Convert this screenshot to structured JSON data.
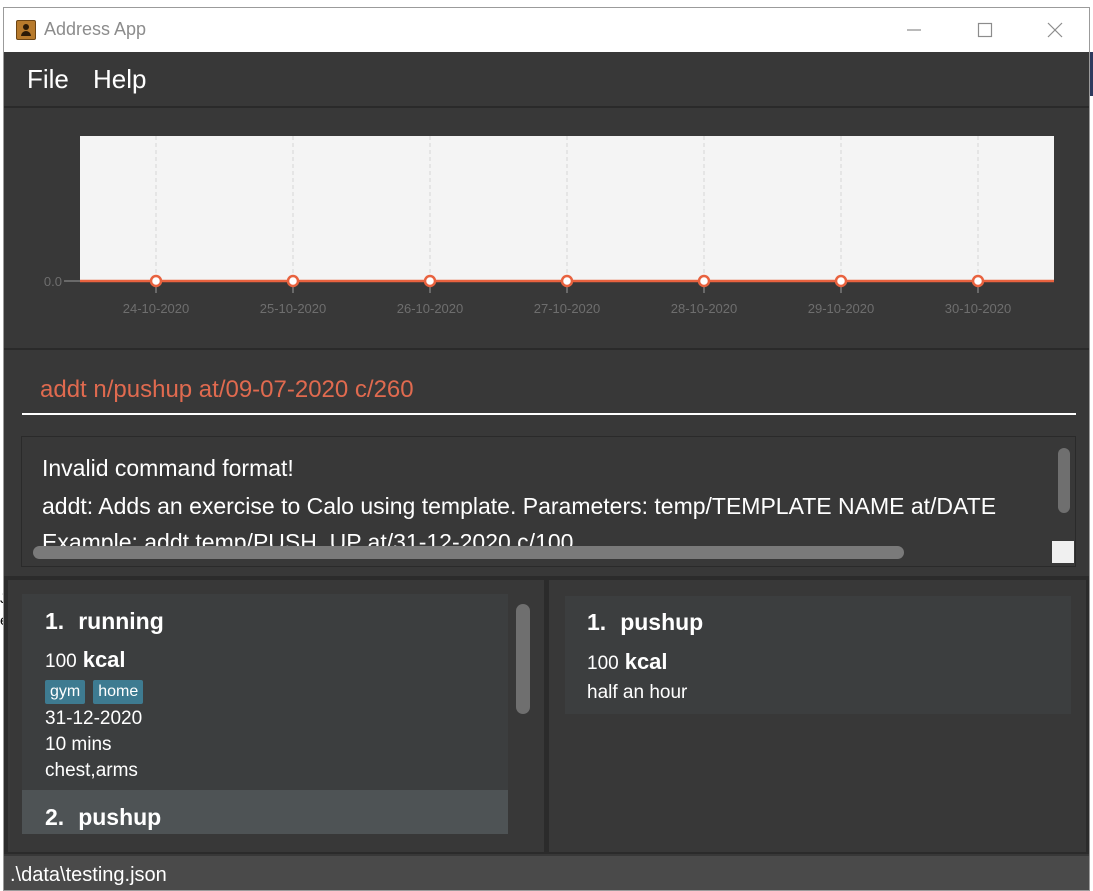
{
  "window": {
    "title": "Address App",
    "icon": "address-book-icon"
  },
  "menu": {
    "file": "File",
    "help": "Help"
  },
  "chart_data": {
    "type": "line",
    "x": [
      "24-10-2020",
      "25-10-2020",
      "26-10-2020",
      "27-10-2020",
      "28-10-2020",
      "29-10-2020",
      "30-10-2020"
    ],
    "series": [
      {
        "values": [
          0,
          0,
          0,
          0,
          0,
          0,
          0
        ],
        "color": "#e8623f"
      }
    ],
    "y_tick_labels": [
      "0.0"
    ],
    "ylim": [
      0,
      1
    ],
    "grid": "vertical-dashed"
  },
  "command": {
    "value": "addt n/pushup at/09-07-2020 c/260",
    "color": "#e06a4f"
  },
  "result": {
    "lines": [
      "Invalid command format!",
      "addt: Adds an exercise to Calo using template. Parameters: temp/TEMPLATE NAME at/DATE",
      "Example: addt temp/PUSH_UP at/31-12-2020 c/100"
    ]
  },
  "exercises": [
    {
      "index": "1.",
      "name": "running",
      "calories": "100",
      "unit": "kcal",
      "tags": [
        "gym",
        "home"
      ],
      "date": "31-12-2020",
      "duration": "10 mins",
      "muscles": "chest,arms"
    },
    {
      "index": "2.",
      "name": "pushup"
    }
  ],
  "templates": [
    {
      "index": "1.",
      "name": "pushup",
      "calories": "100",
      "unit": "kcal",
      "description": "half an hour"
    }
  ],
  "status": {
    "path": ".\\data\\testing.json"
  },
  "colors": {
    "background": "#383838",
    "tag": "#3e7b91",
    "accent": "#e8623f"
  }
}
